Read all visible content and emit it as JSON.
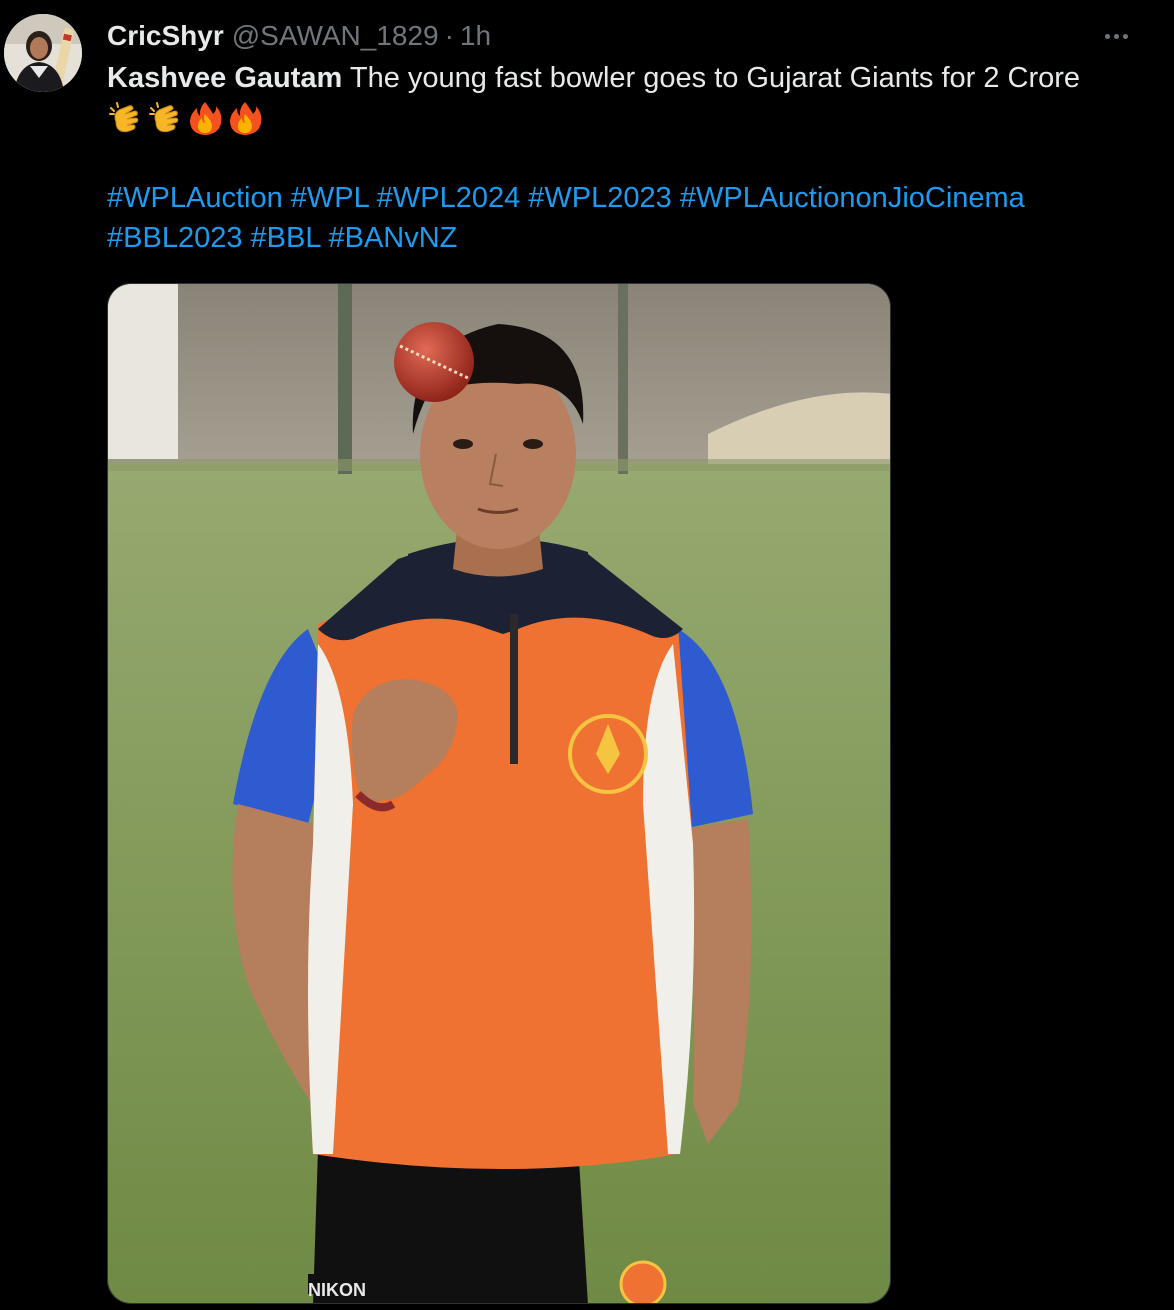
{
  "tweet": {
    "display_name": "CricShyr",
    "handle": "@SAWAN_1829",
    "separator": "·",
    "time": "1h",
    "text_bold": "Kashvee Gautam",
    "text_rest": " The young fast bowler goes to Gujarat Giants for 2 Crore",
    "emojis": [
      "clapping-hands",
      "clapping-hands",
      "fire",
      "fire"
    ],
    "hashtags_line1": [
      "#WPLAuction",
      "#WPL",
      "#WPL2024",
      "#WPL2023",
      "#WPLAuctiononJioCinema"
    ],
    "hashtags_line2": [
      "#BBL2023",
      "#BBL",
      "#BANvNZ"
    ],
    "media": {
      "subject": "photo-cricketer-holding-ball",
      "shirt_logo_text": "NIKON"
    }
  },
  "icons": {
    "more": "more-horizontal-icon"
  },
  "colors": {
    "background": "#000000",
    "primary_text": "#e7e9ea",
    "secondary_text": "#71767b",
    "link": "#1d9bf0",
    "jersey_orange": "#f07233",
    "jersey_navy": "#1c2233",
    "sleeve_blue": "#2f5bd0"
  }
}
